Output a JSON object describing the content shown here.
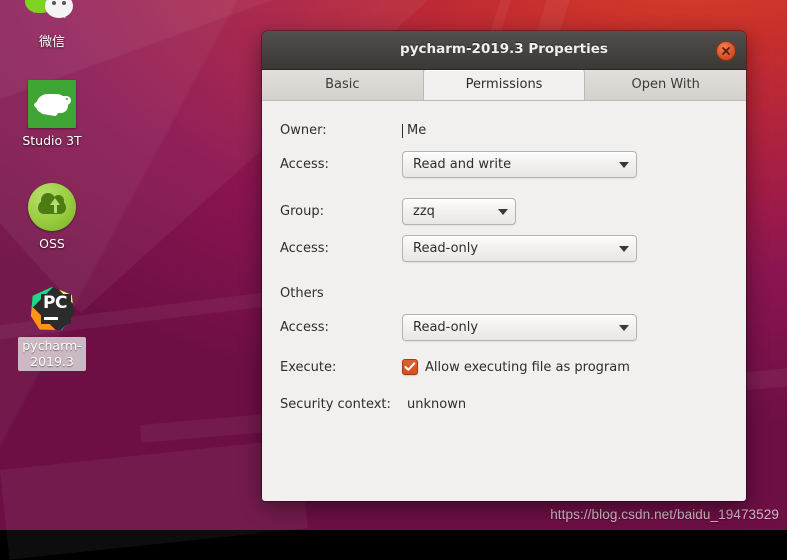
{
  "desktop": {
    "icons": [
      {
        "name": "wechat",
        "label": "微信",
        "selected": false
      },
      {
        "name": "studio3t",
        "label": "Studio 3T",
        "selected": false
      },
      {
        "name": "oss",
        "label": "OSS",
        "selected": false
      },
      {
        "name": "pycharm",
        "label": "pycharm-\n2019.3",
        "label_line1": "pycharm-",
        "label_line2": "2019.3",
        "selected": true
      }
    ],
    "watermark": "https://blog.csdn.net/baidu_19473529"
  },
  "dialog": {
    "title": "pycharm-2019.3 Properties",
    "close_icon": "close-icon",
    "tabs": [
      {
        "label": "Basic",
        "active": false
      },
      {
        "label": "Permissions",
        "active": true
      },
      {
        "label": "Open With",
        "active": false
      }
    ],
    "permissions": {
      "owner": {
        "label": "Owner:",
        "value": "Me",
        "access_label": "Access:",
        "access_value": "Read and write"
      },
      "group": {
        "label": "Group:",
        "value": "zzq",
        "access_label": "Access:",
        "access_value": "Read-only"
      },
      "others": {
        "label": "Others",
        "access_label": "Access:",
        "access_value": "Read-only"
      },
      "execute": {
        "label": "Execute:",
        "checkbox_label": "Allow executing file as program",
        "checked": true
      },
      "security_context": {
        "label": "Security context:",
        "value": "unknown"
      }
    }
  },
  "colors": {
    "accent_orange": "#d2501f",
    "titlebar_dark": "#474441",
    "content_bg": "#f2f0ee",
    "wallpaper_top": "#c9302c",
    "wallpaper_bottom": "#6d0f44"
  }
}
